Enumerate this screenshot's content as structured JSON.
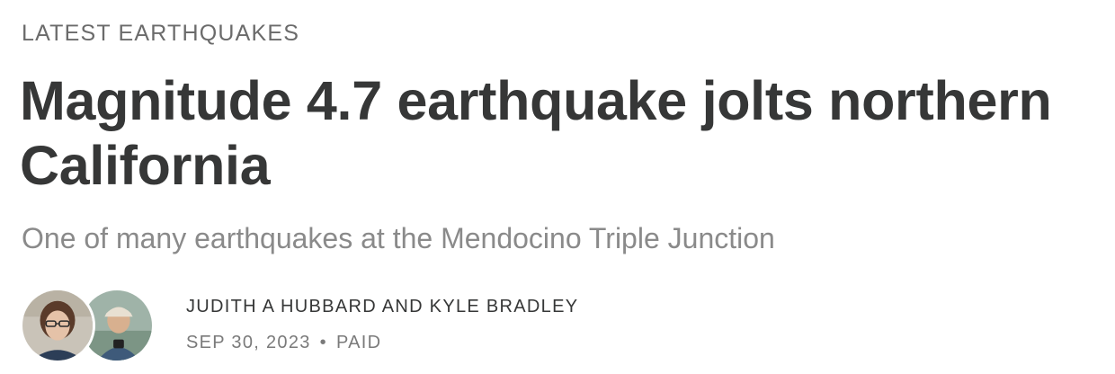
{
  "post": {
    "kicker": "LATEST EARTHQUAKES",
    "title": "Magnitude 4.7 earthquake jolts northern California",
    "subtitle": "One of many earthquakes at the Mendocino Triple Junction",
    "authors": "JUDITH A HUBBARD AND KYLE BRADLEY",
    "date": "SEP 30, 2023",
    "separator": "•",
    "access": "PAID"
  },
  "avatars": [
    {
      "icon": "author-avatar-woman-glasses"
    },
    {
      "icon": "author-avatar-man-cap"
    }
  ],
  "colors": {
    "title": "#363737",
    "subtitle": "#8a8a8a",
    "meta": "#7a7a7a"
  }
}
